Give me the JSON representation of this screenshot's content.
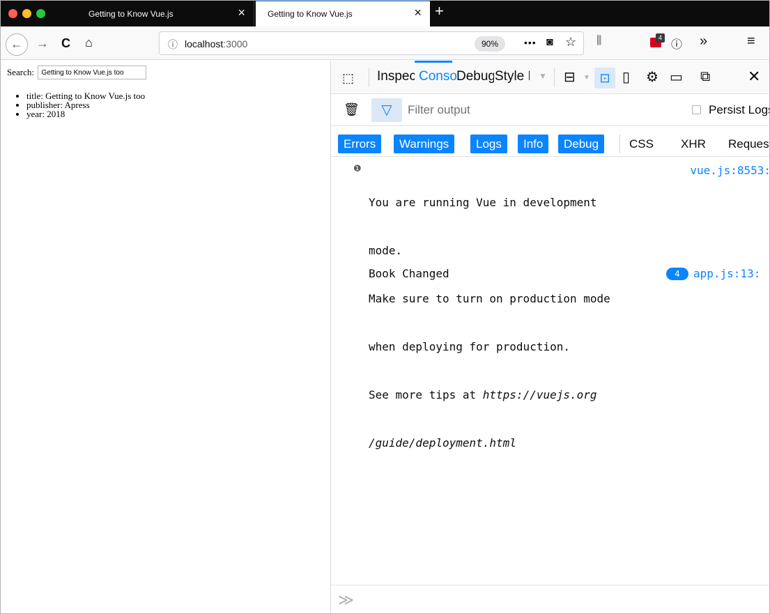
{
  "window": {
    "traffic_lights": [
      "#fe5f57",
      "#febc2e",
      "#28c840"
    ]
  },
  "tabs": [
    {
      "title": "Getting to Know Vue.js",
      "close_icon": "×"
    },
    {
      "title": "Getting to Know Vue.js",
      "close_icon": "×"
    }
  ],
  "new_tab_icon": "+",
  "navbar": {
    "back_icon": "←",
    "forward_icon": "→",
    "reload_icon": "C",
    "home_icon": "⌂",
    "url_info_icon": "ⓘ",
    "url_host": "localhost",
    "url_port": ":3000",
    "zoom": "90%",
    "page_actions_icon": "•••",
    "pocket_icon": "◙",
    "bookmark_icon": "☆",
    "library_icon": "⫼",
    "extension_badge": "4",
    "ext2_icon": "ⓘ",
    "overflow_icon": "»",
    "menu_icon": "≡"
  },
  "page": {
    "search_label": "Search:",
    "search_value": "Getting to Know Vue.js too",
    "book": [
      "title: Getting to Know Vue.js too",
      "publisher: Apress",
      "year: 2018"
    ]
  },
  "devtools": {
    "picker_icon": "⬚",
    "tabs": {
      "inspector": "Inspector",
      "console": "Console",
      "debugger": "Debugger",
      "style": "Style Editor"
    },
    "more_icon": "▼",
    "layout_icon": "⊟",
    "layout_caret": "▼",
    "split_console_icon": "⊡",
    "responsive_icon": "▯",
    "settings_icon": "⚙",
    "dock_icon": "▭",
    "window_icon": "⧉",
    "close_icon": "✕",
    "trash_icon": "🗑",
    "filter_icon": "▽",
    "filter_placeholder": "Filter output",
    "persist_label": "Persist Logs",
    "categories": {
      "errors": "Errors",
      "warnings": "Warnings",
      "logs": "Logs",
      "info": "Info",
      "debug": "Debug"
    },
    "net": {
      "css": "CSS",
      "xhr": "XHR",
      "requests": "Requests"
    },
    "messages": [
      {
        "icon": "❶",
        "line1": "You are running Vue in development",
        "line2": "mode.",
        "line3": "Make sure to turn on production mode",
        "line4": "when deploying for production.",
        "line5_prefix": "See more tips at ",
        "line5_link": "https://vuejs.org",
        "line6_link": "/guide/deployment.html",
        "source": "vue.js:8553:"
      },
      {
        "text": "Book Changed",
        "repeat": "4",
        "source": "app.js:13:"
      }
    ],
    "prompt_icon": "≫"
  }
}
